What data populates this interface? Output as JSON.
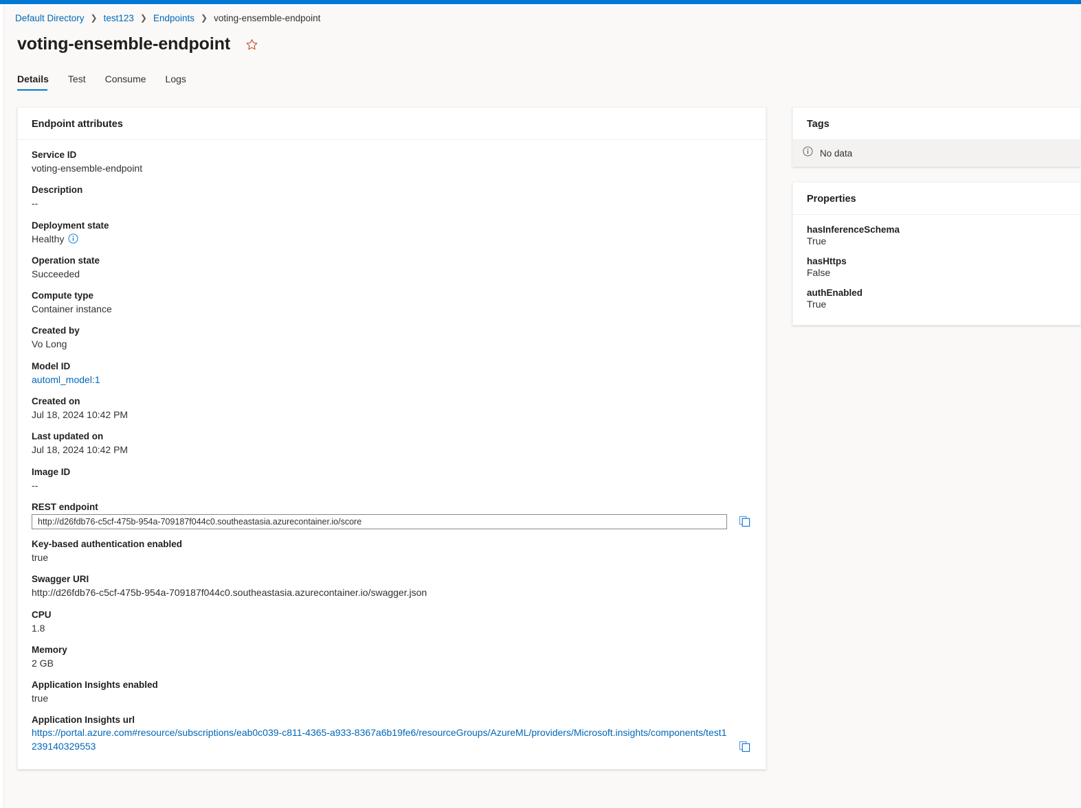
{
  "breadcrumb": [
    {
      "label": "Default Directory",
      "link": true
    },
    {
      "label": "test123",
      "link": true
    },
    {
      "label": "Endpoints",
      "link": true
    },
    {
      "label": "voting-ensemble-endpoint",
      "link": false
    }
  ],
  "header": {
    "title": "voting-ensemble-endpoint",
    "favorite_icon": "star-icon"
  },
  "tabs": [
    {
      "label": "Details",
      "active": true
    },
    {
      "label": "Test",
      "active": false
    },
    {
      "label": "Consume",
      "active": false
    },
    {
      "label": "Logs",
      "active": false
    }
  ],
  "endpoint_attributes": {
    "title": "Endpoint attributes",
    "service_id": {
      "label": "Service ID",
      "value": "voting-ensemble-endpoint"
    },
    "description": {
      "label": "Description",
      "value": "--"
    },
    "deployment_state": {
      "label": "Deployment state",
      "value": "Healthy",
      "info_icon": "info-icon"
    },
    "operation_state": {
      "label": "Operation state",
      "value": "Succeeded"
    },
    "compute_type": {
      "label": "Compute type",
      "value": "Container instance"
    },
    "created_by": {
      "label": "Created by",
      "value": "Vo Long"
    },
    "model_id": {
      "label": "Model ID",
      "value": "automl_model:1"
    },
    "created_on": {
      "label": "Created on",
      "value": "Jul 18, 2024 10:42 PM"
    },
    "last_updated_on": {
      "label": "Last updated on",
      "value": "Jul 18, 2024 10:42 PM"
    },
    "image_id": {
      "label": "Image ID",
      "value": "--"
    },
    "rest_endpoint": {
      "label": "REST endpoint",
      "value": "http://d26fdb76-c5cf-475b-954a-709187f044c0.southeastasia.azurecontainer.io/score",
      "copy_icon": "copy-icon"
    },
    "key_auth": {
      "label": "Key-based authentication enabled",
      "value": "true"
    },
    "swagger_uri": {
      "label": "Swagger URI",
      "value": "http://d26fdb76-c5cf-475b-954a-709187f044c0.southeastasia.azurecontainer.io/swagger.json"
    },
    "cpu": {
      "label": "CPU",
      "value": "1.8"
    },
    "memory": {
      "label": "Memory",
      "value": "2 GB"
    },
    "app_insights_enabled": {
      "label": "Application Insights enabled",
      "value": "true"
    },
    "app_insights_url": {
      "label": "Application Insights url",
      "value": "https://portal.azure.com#resource/subscriptions/eab0c039-c811-4365-a933-8367a6b19fe6/resourceGroups/AzureML/providers/Microsoft.insights/components/test1239140329553",
      "copy_icon": "copy-icon"
    }
  },
  "tags": {
    "title": "Tags",
    "empty_text": "No data",
    "empty_icon": "info-icon"
  },
  "properties": {
    "title": "Properties",
    "items": [
      {
        "label": "hasInferenceSchema",
        "value": "True"
      },
      {
        "label": "hasHttps",
        "value": "False"
      },
      {
        "label": "authEnabled",
        "value": "True"
      }
    ]
  },
  "colors": {
    "accent": "#0078d4",
    "link": "#0067b8",
    "favorite": "#c94f2c",
    "background": "#faf9f8"
  }
}
